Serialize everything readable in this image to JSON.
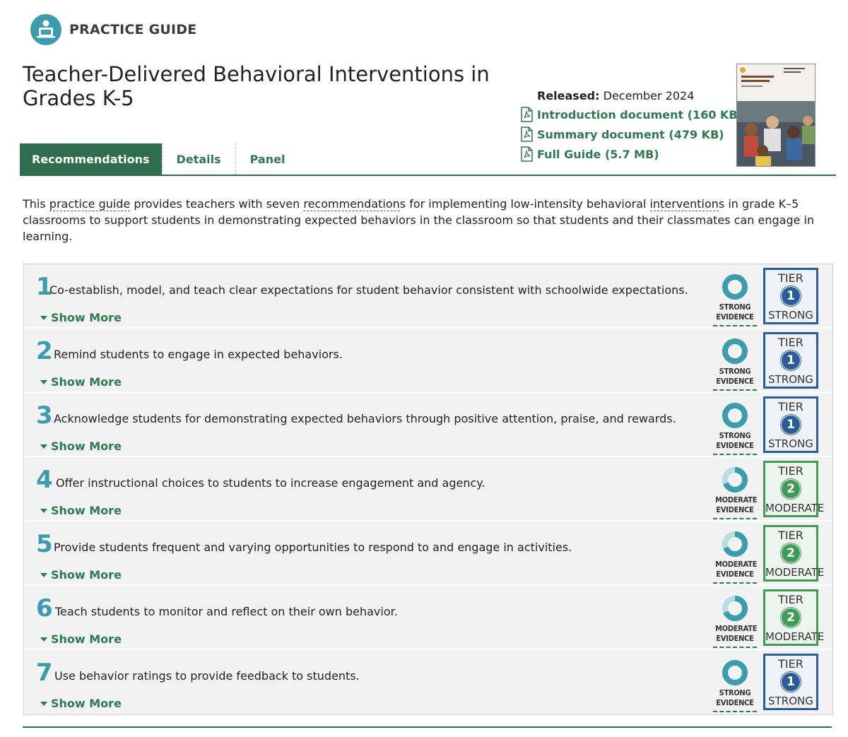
{
  "header": {
    "brand": "PRACTICE GUIDE",
    "icon": "teacher-computer-icon"
  },
  "title": "Teacher-Delivered Behavioral Interventions in Grades K-5",
  "meta": {
    "released_label": "Released:",
    "released_value": "December 2024",
    "documents": [
      {
        "label": "Introduction document (160 KB)",
        "icon": "pdf-icon"
      },
      {
        "label": "Summary document (479 KB)",
        "icon": "pdf-icon"
      },
      {
        "label": "Full Guide (5.7 MB)",
        "icon": "pdf-icon"
      }
    ]
  },
  "tabs": [
    {
      "label": "Recommendations",
      "active": true
    },
    {
      "label": "Details",
      "active": false
    },
    {
      "label": "Panel",
      "active": false
    }
  ],
  "intro": {
    "p1": "This ",
    "t1": "practice guide",
    "p2": " provides teachers with seven ",
    "t2": "recommendation",
    "p3": "s for implementing low-intensity behavioral ",
    "t3": "intervention",
    "p4": "s in grade K–5 classrooms to support students in demonstrating expected behaviors in the classroom so that students and their classmates can engage in learning."
  },
  "recommendations": [
    {
      "number": "1",
      "text": "Co-establish, model, and teach clear expectations for student behavior consistent with schoolwide expectations.",
      "show_more": "Show More",
      "evidence_line1": "STRONG",
      "evidence_line2": "EVIDENCE",
      "tier_word": "TIER",
      "tier_number": "1",
      "tier_level": "STRONG"
    },
    {
      "number": "2",
      "text": "Remind students to engage in expected behaviors.",
      "show_more": "Show More",
      "evidence_line1": "STRONG",
      "evidence_line2": "EVIDENCE",
      "tier_word": "TIER",
      "tier_number": "1",
      "tier_level": "STRONG"
    },
    {
      "number": "3",
      "text": "Acknowledge students for demonstrating expected behaviors through positive attention, praise, and rewards.",
      "show_more": "Show More",
      "evidence_line1": "STRONG",
      "evidence_line2": "EVIDENCE",
      "tier_word": "TIER",
      "tier_number": "1",
      "tier_level": "STRONG"
    },
    {
      "number": "4",
      "text": "Offer instructional choices to students to increase engagement and agency.",
      "show_more": "Show More",
      "evidence_line1": "MODERATE",
      "evidence_line2": "EVIDENCE",
      "tier_word": "TIER",
      "tier_number": "2",
      "tier_level": "MODERATE"
    },
    {
      "number": "5",
      "text": "Provide students frequent and varying opportunities to respond to and engage in activities.",
      "show_more": "Show More",
      "evidence_line1": "MODERATE",
      "evidence_line2": "EVIDENCE",
      "tier_word": "TIER",
      "tier_number": "2",
      "tier_level": "MODERATE"
    },
    {
      "number": "6",
      "text": "Teach students to monitor and reflect on their own behavior.",
      "show_more": "Show More",
      "evidence_line1": "MODERATE",
      "evidence_line2": "EVIDENCE",
      "tier_word": "TIER",
      "tier_number": "2",
      "tier_level": "MODERATE"
    },
    {
      "number": "7",
      "text": "Use behavior ratings to provide feedback to students.",
      "show_more": "Show More",
      "evidence_line1": "STRONG",
      "evidence_line2": "EVIDENCE",
      "tier_word": "TIER",
      "tier_number": "1",
      "tier_level": "STRONG"
    }
  ],
  "colors": {
    "accent_green": "#2e7a50",
    "teal": "#3a9cad",
    "tier1_blue": "#2a5c9a",
    "tier2_green": "#3f9c55"
  }
}
